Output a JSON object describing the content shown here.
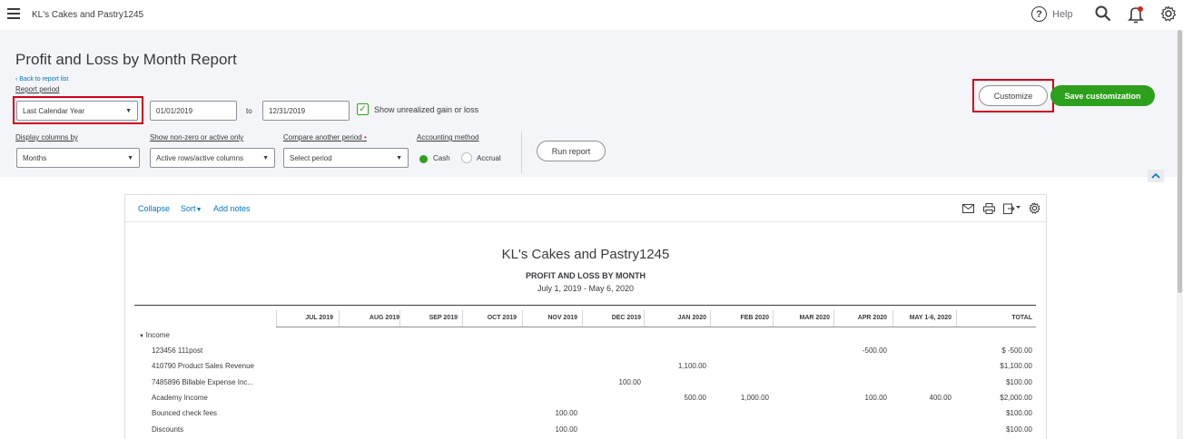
{
  "topbar": {
    "company_name": "KL's Cakes and Pastry1245",
    "help_label": "Help",
    "help_glyph": "?"
  },
  "header": {
    "title": "Profit and Loss by Month Report",
    "back_link": "Back to report list",
    "report_period_label": "Report period",
    "report_period_value": "Last Calendar Year",
    "from_date": "01/01/2019",
    "to_label": "to",
    "to_date": "12/31/2019",
    "unrealized_label": "Show unrealized gain or loss",
    "unrealized_checked": true,
    "display_columns_label": "Display columns by",
    "display_columns_value": "Months",
    "non_zero_label": "Show non-zero or active only",
    "non_zero_value": "Active rows/active columns",
    "compare_label": "Compare another period",
    "compare_required": "•",
    "compare_value": "Select period",
    "accounting_label": "Accounting method",
    "cash_label": "Cash",
    "accrual_label": "Accrual",
    "selected_method": "Cash",
    "run_report": "Run report",
    "customize": "Customize",
    "save_customization": "Save customization"
  },
  "report_toolbar": {
    "collapse": "Collapse",
    "sort": "Sort",
    "add_notes": "Add notes"
  },
  "report": {
    "company": "KL's Cakes and Pastry1245",
    "title": "PROFIT AND LOSS BY MONTH",
    "range": "July 1, 2019 - May 6, 2020",
    "columns": [
      "JUL 2019",
      "AUG 2019",
      "SEP 2019",
      "OCT 2019",
      "NOV 2019",
      "DEC 2019",
      "JAN 2020",
      "FEB 2020",
      "MAR 2020",
      "APR 2020",
      "MAY 1-6, 2020",
      "TOTAL"
    ],
    "section": "Income",
    "rows": [
      {
        "label": "123456 111post",
        "values": [
          "",
          "",
          "",
          "",
          "",
          "",
          "",
          "",
          "",
          "-500.00",
          "",
          "$ -500.00"
        ]
      },
      {
        "label": "410790 Product Sales Revenue",
        "values": [
          "",
          "",
          "",
          "",
          "",
          "",
          "1,100.00",
          "",
          "",
          "",
          "",
          "$1,100.00"
        ]
      },
      {
        "label": "7485896 Billable Expense Inc...",
        "values": [
          "",
          "",
          "",
          "",
          "",
          "100.00",
          "",
          "",
          "",
          "",
          "",
          "$100.00"
        ]
      },
      {
        "label": "Academy Income",
        "values": [
          "",
          "",
          "",
          "",
          "",
          "",
          "500.00",
          "1,000.00",
          "",
          "100.00",
          "400.00",
          "$2,000.00"
        ]
      },
      {
        "label": "Bounced check fees",
        "values": [
          "",
          "",
          "",
          "",
          "100.00",
          "",
          "",
          "",
          "",
          "",
          "",
          "$100.00"
        ]
      },
      {
        "label": "Discounts",
        "values": [
          "",
          "",
          "",
          "",
          "100.00",
          "",
          "",
          "",
          "",
          "",
          "",
          "$100.00"
        ]
      }
    ]
  },
  "colors": {
    "accent_green": "#2ca01c",
    "link_blue": "#0077c5",
    "highlight_red": "#d0021b",
    "notification_red": "#d52b1e"
  }
}
